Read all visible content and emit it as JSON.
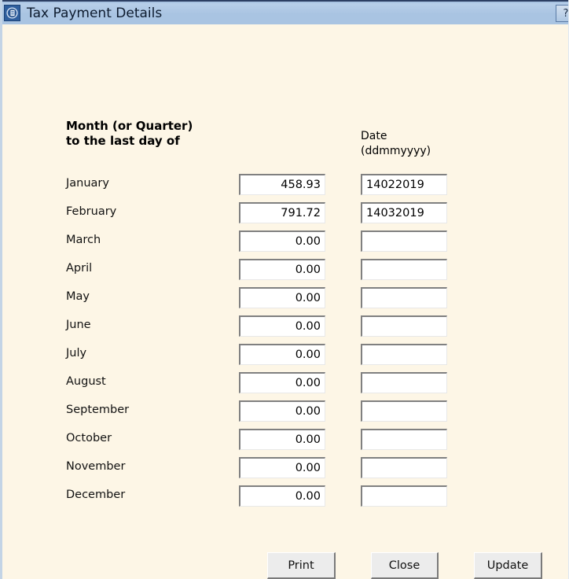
{
  "window": {
    "title": "Tax Payment Details",
    "app_icon": "document-circle-icon",
    "help_label": "?",
    "background_color": "#fdf6e6",
    "titlebar_color": "#a9c4e2"
  },
  "form": {
    "headers": {
      "month_column": "Month (or Quarter)\nto the last day of",
      "date_column": "Date\n(ddmmyyyy)"
    },
    "rows": [
      {
        "month": "January",
        "amount": "458.93",
        "date": "14022019"
      },
      {
        "month": "February",
        "amount": "791.72",
        "date": "14032019"
      },
      {
        "month": "March",
        "amount": "0.00",
        "date": ""
      },
      {
        "month": "April",
        "amount": "0.00",
        "date": ""
      },
      {
        "month": "May",
        "amount": "0.00",
        "date": ""
      },
      {
        "month": "June",
        "amount": "0.00",
        "date": ""
      },
      {
        "month": "July",
        "amount": "0.00",
        "date": ""
      },
      {
        "month": "August",
        "amount": "0.00",
        "date": ""
      },
      {
        "month": "September",
        "amount": "0.00",
        "date": ""
      },
      {
        "month": "October",
        "amount": "0.00",
        "date": ""
      },
      {
        "month": "November",
        "amount": "0.00",
        "date": ""
      },
      {
        "month": "December",
        "amount": "0.00",
        "date": ""
      }
    ]
  },
  "buttons": {
    "print": "Print",
    "close": "Close",
    "update": "Update"
  }
}
